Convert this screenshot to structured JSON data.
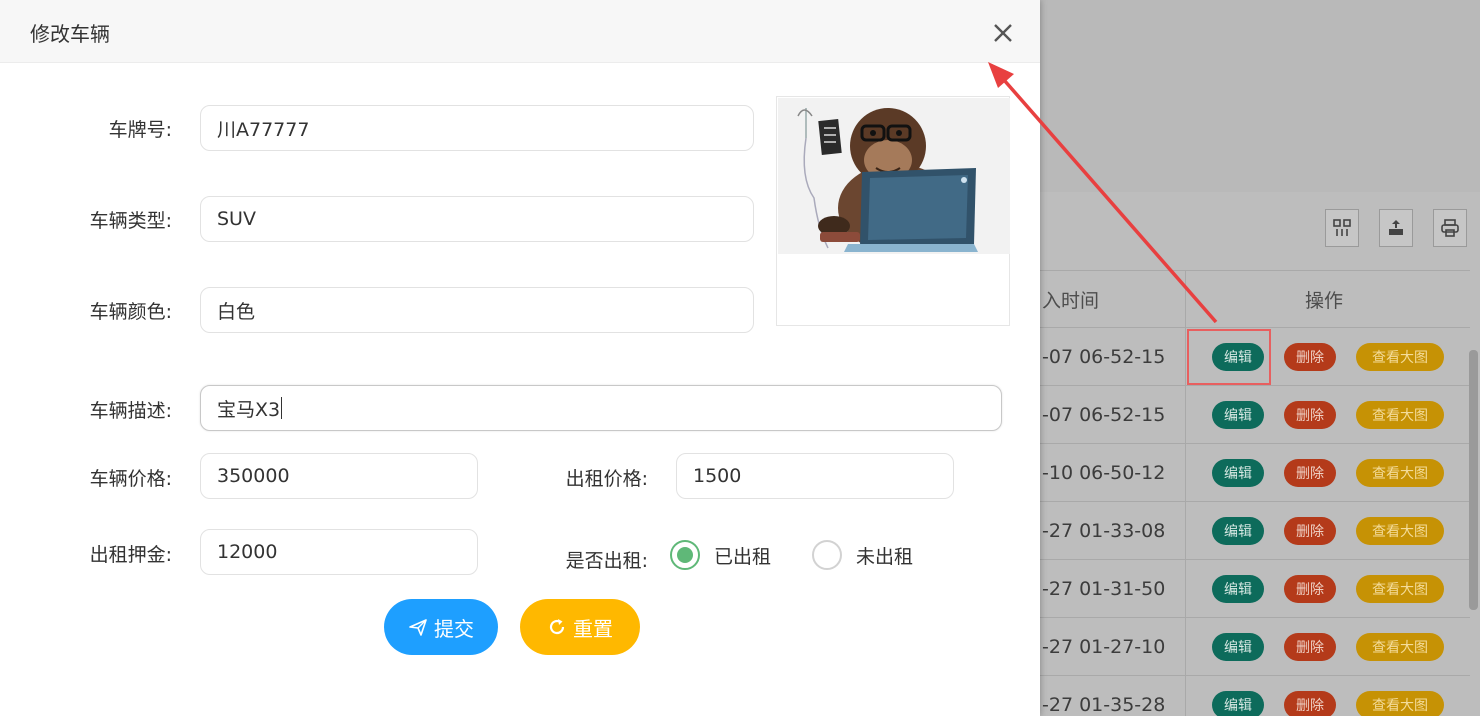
{
  "dialog": {
    "title": "修改车辆",
    "close_icon": "close-icon"
  },
  "form": {
    "plate": {
      "label": "车牌号:",
      "value": "川A77777"
    },
    "type": {
      "label": "车辆类型:",
      "value": "SUV"
    },
    "color": {
      "label": "车辆颜色:",
      "value": "白色"
    },
    "desc": {
      "label": "车辆描述:",
      "value": "宝马X3"
    },
    "price": {
      "label": "车辆价格:",
      "value": "350000"
    },
    "rent_price": {
      "label": "出租价格:",
      "value": "1500"
    },
    "deposit": {
      "label": "出租押金:",
      "value": "12000"
    },
    "rented": {
      "label": "是否出租:",
      "options": [
        "已出租",
        "未出租"
      ],
      "selected": "已出租"
    },
    "submit_label": "提交",
    "reset_label": "重置"
  },
  "background": {
    "table": {
      "time_header": "入时间",
      "ops_header": "操作",
      "rows": [
        "-07 06-52-15",
        "-07 06-52-15",
        "-10 06-50-12",
        "-27 01-33-08",
        "-27 01-31-50",
        "-27 01-27-10",
        "-27 01-35-28"
      ],
      "edit_label": "编辑",
      "delete_label": "删除",
      "view_label": "查看大图"
    },
    "toolbar_icons": [
      "columns-icon",
      "export-icon",
      "print-icon"
    ]
  },
  "colors": {
    "submit": "#1e9fff",
    "reset": "#ffb800",
    "radio_checked": "#5fb878",
    "annotation": "#e84040"
  }
}
